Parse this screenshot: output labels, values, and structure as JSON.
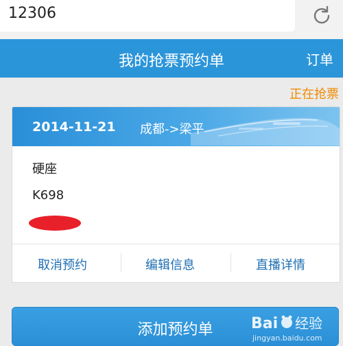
{
  "address_bar": {
    "value": "12306",
    "refresh_icon": "refresh-icon"
  },
  "header": {
    "title": "我的抢票预约单",
    "orders_label": "订单"
  },
  "status": {
    "text": "正在抢票",
    "color": "#f08a00"
  },
  "booking": {
    "date": "2014-11-21",
    "route": "成都->梁平",
    "seat": "硬座",
    "train_no": "K698",
    "actions": [
      "取消预约",
      "编辑信息",
      "直播详情"
    ]
  },
  "add_button": {
    "label": "添加预约单"
  },
  "watermark": {
    "brand": "Baidu经验",
    "url": "jingyan.baidu.com"
  },
  "colors": {
    "accent": "#2b95da",
    "link": "#1f6fb3",
    "redaction": "#e8202a"
  }
}
